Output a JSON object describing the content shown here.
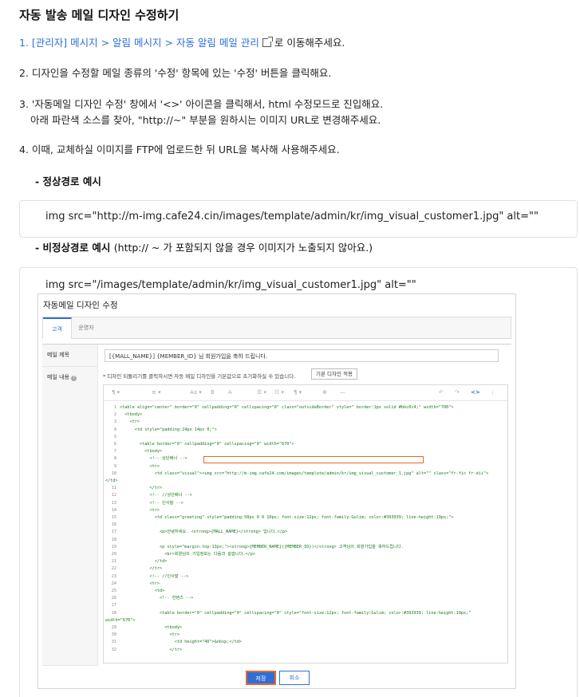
{
  "title": "자동 발송 메일 디자인 수정하기",
  "steps": {
    "s1_link": "1. [관리자] 메시지 > 알림 메시지 > 자동 알림 메일 관리",
    "s1_suffix": "로 이동해주세요.",
    "s2": "2. 디자인을 수정할 메일 종류의 '수정' 항목에 있는 '수정' 버튼을 클릭해요.",
    "s3a": "3. '자동메일 디자인 수정' 창에서 '<>' 아이콘을 클릭해서, html 수정모드로 진입해요.",
    "s3b": "아래 파란색 소스를 찾아, \"http://~\" 부분을 원하시는 이미지 URL로 변경해주세요.",
    "s4": "4. 이때, 교체하실 이미지를 FTP에 업로드한 뒤 URL을 복사해 사용해주세요."
  },
  "normal_example": {
    "label": "- 정상경로 예시",
    "code": "img src=\"http://m-img.cafe24.cin/images/template/admin/kr/img_visual_customer1.jpg\" alt=\"\""
  },
  "abnormal_example": {
    "label": "- 비정상경로 예시",
    "note": "(http:// ~ 가 포함되지 않을 경우 이미지가 노출되지 않아요.)",
    "code": "img src=\"/images/template/admin/kr/img_visual_customer1.jpg\" alt=\"\""
  },
  "modal": {
    "title": "자동메일 디자인 수정",
    "tabs": [
      "고객",
      "운영자"
    ],
    "subject_label": "메일 제목",
    "subject_value": "[{MALL_NAME}] {MEMBER_ID} 님 회원가입을 축하 드립니다.",
    "content_label": "메일 내용",
    "hint": "* 디자인 되돌리기를 클릭하시면 자동 메일 디자인을 기본값으로 초기화하실 수 있습니다.",
    "basic_button": "기본 디자인 적용",
    "save": "저장",
    "cancel": "취소",
    "code_lines": [
      {
        "n": "1",
        "t": "<table align=\"center\" border=\"0\" cellpadding=\"0\" cellspacing=\"0\" class=\"outsideBorder\" style=\" border:1px solid #bbc0c4;\" width=\"700\">"
      },
      {
        "n": "2",
        "t": "  <tbody>"
      },
      {
        "n": "3",
        "t": "    <tr>"
      },
      {
        "n": "4",
        "t": "      <td style=\"padding:24px 14px 0;\">"
      },
      {
        "n": "5",
        "t": ""
      },
      {
        "n": "6",
        "t": "        <table border=\"0\" cellpadding=\"0\" cellspacing=\"0\" width=\"670\">"
      },
      {
        "n": "7",
        "t": "          <tbody>"
      },
      {
        "n": "8",
        "t": "            <!-- 상단배너 -->"
      },
      {
        "n": "9",
        "t": "            <tr>"
      },
      {
        "n": "10",
        "t": "              <td class=\"visual\"><img src=\"http://m-img.cafe24.com/images/template/admin/kr/img_visual_customer_1.jpg\" alt=\"\" class=\"fr-fic fr-dii\">"
      },
      {
        "n": "",
        "t": "</td>"
      },
      {
        "n": "11",
        "t": "            </tr>"
      },
      {
        "n": "12",
        "t": "            <!-- //상단배너 -->"
      },
      {
        "n": "13",
        "t": "            <!-- 인사말 -->"
      },
      {
        "n": "14",
        "t": "            <tr>"
      },
      {
        "n": "15",
        "t": "              <td class=\"greeting\" style=\"padding:50px 0 0 10px; font-size:12px; font-family:Gulim; color:#393939; line-height:19px;\">"
      },
      {
        "n": "16",
        "t": ""
      },
      {
        "n": "17",
        "t": "                <p>안녕하세요. <strong>{MALL_NAME}</strong> 입니다.</p>"
      },
      {
        "n": "18",
        "t": ""
      },
      {
        "n": "19",
        "t": "                <p style=\"margin-top:13px;\"><strong>{MEMBER_NAME}({MEMBER_ID})</strong> 고객님의 회원가입을 축하드립니다."
      },
      {
        "n": "20",
        "t": "                  <br>회원님의 가입정보는 다음과 같습니다.</p>"
      },
      {
        "n": "21",
        "t": "              </td>"
      },
      {
        "n": "22",
        "t": "            </tr>"
      },
      {
        "n": "23",
        "t": "            <!-- //인사말 -->"
      },
      {
        "n": "24",
        "t": "            <tr>"
      },
      {
        "n": "25",
        "t": "              <td>"
      },
      {
        "n": "26",
        "t": "                <!-- 컨텐츠 -->"
      },
      {
        "n": "27",
        "t": ""
      },
      {
        "n": "28",
        "t": "                <table border=\"0\" cellpadding=\"0\" cellspacing=\"0\" style=\"font-size:12px; font-family:Gulim; color:#393939; line-height:19px;\""
      },
      {
        "n": "",
        "t": "width=\"670\">"
      },
      {
        "n": "29",
        "t": "                  <tbody>"
      },
      {
        "n": "30",
        "t": "                    <tr>"
      },
      {
        "n": "31",
        "t": "                      <td height=\"40\">&nbsp;</td>"
      },
      {
        "n": "32",
        "t": "                    </tr>"
      }
    ]
  }
}
